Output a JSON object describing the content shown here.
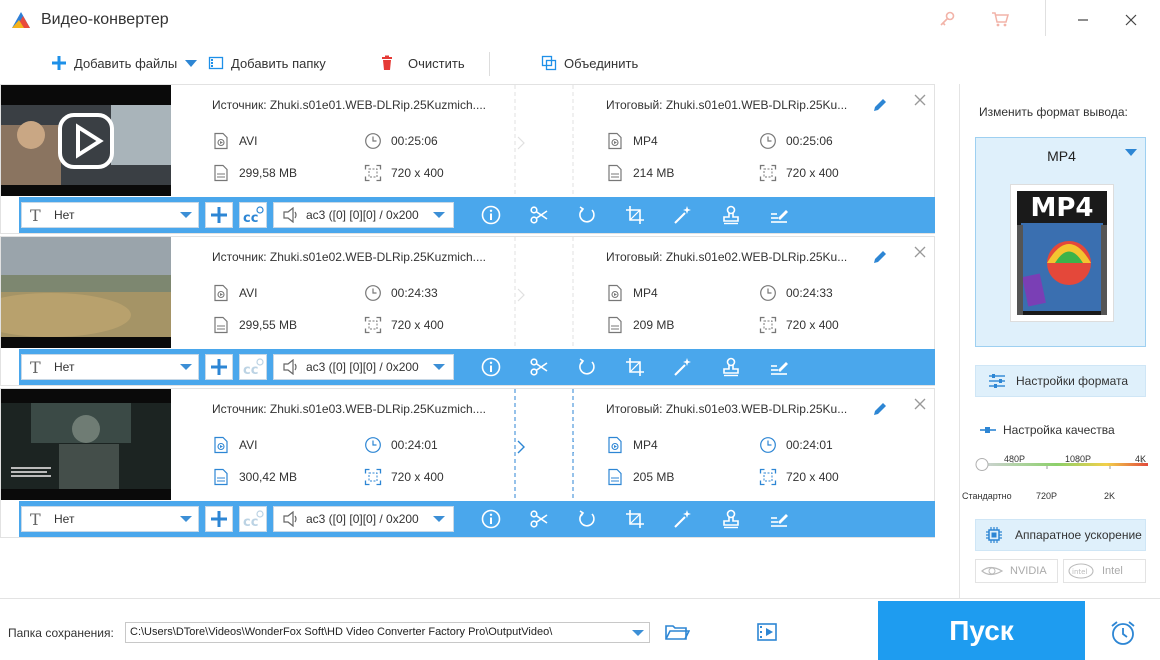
{
  "window": {
    "title": "Видео-конвертер"
  },
  "toolbar": {
    "add_files": "Добавить файлы",
    "add_folder": "Добавить папку",
    "clear": "Очистить",
    "merge": "Объединить"
  },
  "files": [
    {
      "source_label": "Источник: Zhuki.s01e01.WEB-DLRip.25Kuzmich....",
      "output_label": "Итоговый: Zhuki.s01e01.WEB-DLRip.25Ku...",
      "src_format": "AVI",
      "src_duration": "00:25:06",
      "src_size": "299,58 MB",
      "src_resolution": "720 x 400",
      "dst_format": "MP4",
      "dst_duration": "00:25:06",
      "dst_size": "214 MB",
      "dst_resolution": "720 x 400",
      "subtitle": "Нет",
      "audio": "ac3 ([0] [0][0] / 0x200"
    },
    {
      "source_label": "Источник: Zhuki.s01e02.WEB-DLRip.25Kuzmich....",
      "output_label": "Итоговый: Zhuki.s01e02.WEB-DLRip.25Ku...",
      "src_format": "AVI",
      "src_duration": "00:24:33",
      "src_size": "299,55 MB",
      "src_resolution": "720 x 400",
      "dst_format": "MP4",
      "dst_duration": "00:24:33",
      "dst_size": "209 MB",
      "dst_resolution": "720 x 400",
      "subtitle": "Нет",
      "audio": "ac3 ([0] [0][0] / 0x200"
    },
    {
      "source_label": "Источник: Zhuki.s01e03.WEB-DLRip.25Kuzmich....",
      "output_label": "Итоговый: Zhuki.s01e03.WEB-DLRip.25Ku...",
      "src_format": "AVI",
      "src_duration": "00:24:01",
      "src_size": "300,42 MB",
      "src_resolution": "720 x 400",
      "dst_format": "MP4",
      "dst_duration": "00:24:01",
      "dst_size": "205 MB",
      "dst_resolution": "720 x 400",
      "subtitle": "Нет",
      "audio": "ac3 ([0] [0][0] / 0x200"
    }
  ],
  "right_panel": {
    "change_format_label": "Изменить формат вывода:",
    "format_name": "MP4",
    "format_image_text": "MP4",
    "format_settings": "Настройки формата",
    "quality_label": "Настройка качества",
    "quality_ticks_top": [
      "480P",
      "1080P",
      "4K"
    ],
    "quality_ticks_bottom": [
      "Стандартно",
      "720P",
      "2K"
    ],
    "quality_level": 0,
    "hw_accel": "Аппаратное ускорение",
    "nvidia": "NVIDIA",
    "intel": "Intel"
  },
  "bottom": {
    "save_folder_label": "Папка сохранения:",
    "save_path": "C:\\Users\\DTore\\Videos\\WonderFox Soft\\HD Video Converter Factory Pro\\OutputVideo\\",
    "run_label": "Пуск"
  },
  "colors": {
    "accent": "#1e9cf0",
    "bar_blue": "#4aa7ec",
    "panel_bg": "#dff0fb"
  }
}
